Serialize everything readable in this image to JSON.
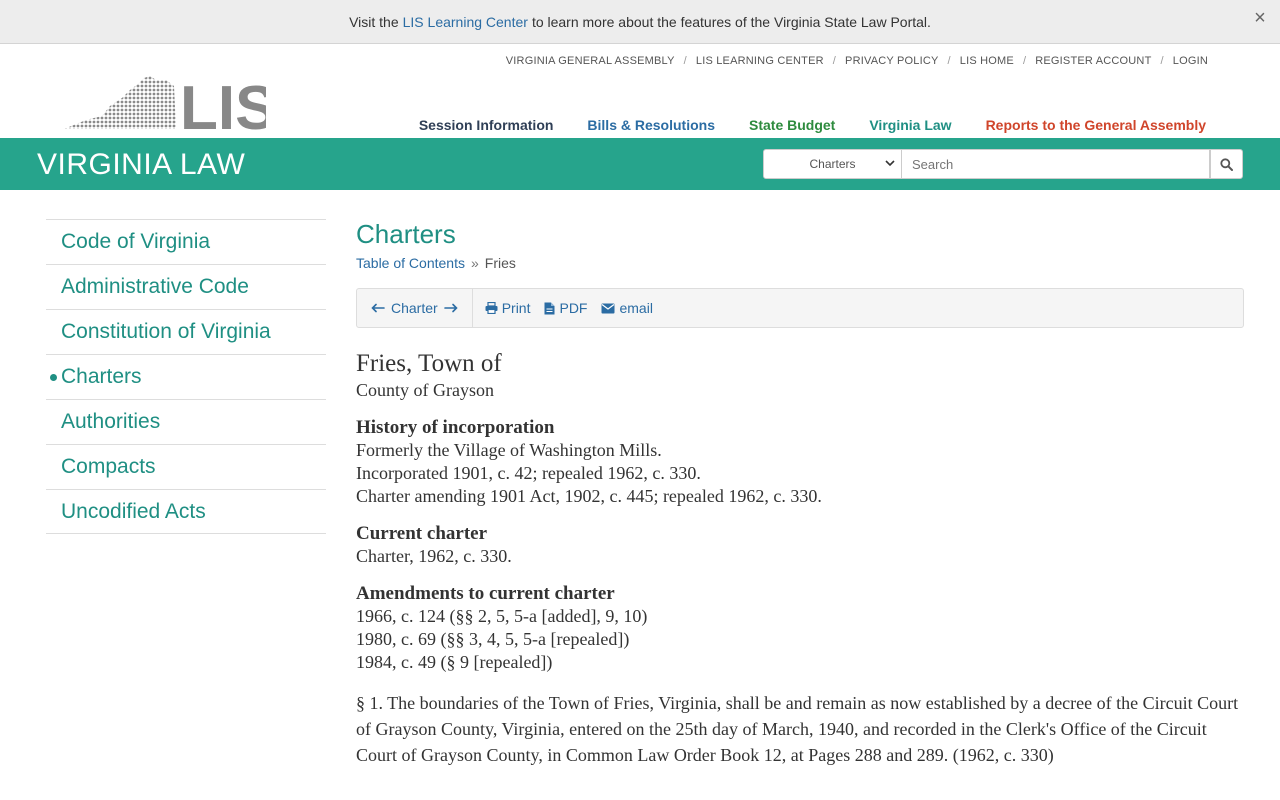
{
  "banner": {
    "text_before": "Visit the",
    "link": "LIS Learning Center",
    "text_after": "to learn more about the features of the Virginia State Law Portal.",
    "close": "×"
  },
  "utility_nav": {
    "items": [
      "VIRGINIA GENERAL ASSEMBLY",
      "LIS LEARNING CENTER",
      "PRIVACY POLICY",
      "LIS HOME",
      "REGISTER ACCOUNT",
      "LOGIN"
    ],
    "separator": "/"
  },
  "logo": {
    "text": "LIS"
  },
  "main_nav": {
    "items": [
      "Session Information",
      "Bills & Resolutions",
      "State Budget",
      "Virginia Law",
      "Reports to the General Assembly"
    ]
  },
  "greenbar": {
    "title": "VIRGINIA LAW"
  },
  "search": {
    "selected": "Charters",
    "placeholder": "Search"
  },
  "sidebar": {
    "items": [
      {
        "label": "Code of Virginia"
      },
      {
        "label": "Administrative Code"
      },
      {
        "label": "Constitution of Virginia"
      },
      {
        "label": "Charters"
      },
      {
        "label": "Authorities"
      },
      {
        "label": "Compacts"
      },
      {
        "label": "Uncodified Acts"
      }
    ]
  },
  "content": {
    "title": "Charters",
    "breadcrumb": {
      "link": "Table of Contents",
      "sep": "»",
      "current": "Fries"
    },
    "toolbar": {
      "charter": "Charter",
      "print": "Print",
      "pdf": "PDF",
      "email": "email"
    },
    "doc": {
      "heading": "Fries, Town of",
      "county": "County of Grayson",
      "history_heading": "History of incorporation",
      "history_lines": [
        "Formerly the Village of Washington Mills.",
        "Incorporated 1901, c. 42; repealed 1962, c. 330.",
        "Charter amending 1901 Act, 1902, c. 445; repealed 1962, c. 330."
      ],
      "current_heading": "Current charter",
      "current_lines": [
        "Charter, 1962, c. 330."
      ],
      "amend_heading": "Amendments to current charter",
      "amend_lines": [
        "1966, c. 124 (§§ 2, 5, 5-a [added], 9, 10)",
        "1980, c. 69 (§§ 3, 4, 5, 5-a [repealed])",
        "1984, c. 49 (§ 9 [repealed])"
      ],
      "section1": "§ 1. The boundaries of the Town of Fries, Virginia, shall be and remain as now established by a decree of the Circuit Court of Grayson County, Virginia, entered on the 25th day of March, 1940, and recorded in the Clerk's Office of the Circuit Court of Grayson County, in Common Law Order Book 12, at Pages 288 and 289.  (1962, c. 330)"
    }
  },
  "colors": {
    "brand_green": "#26a48c",
    "link_blue": "#2b6ca3",
    "teal_text": "#1f8f83"
  }
}
